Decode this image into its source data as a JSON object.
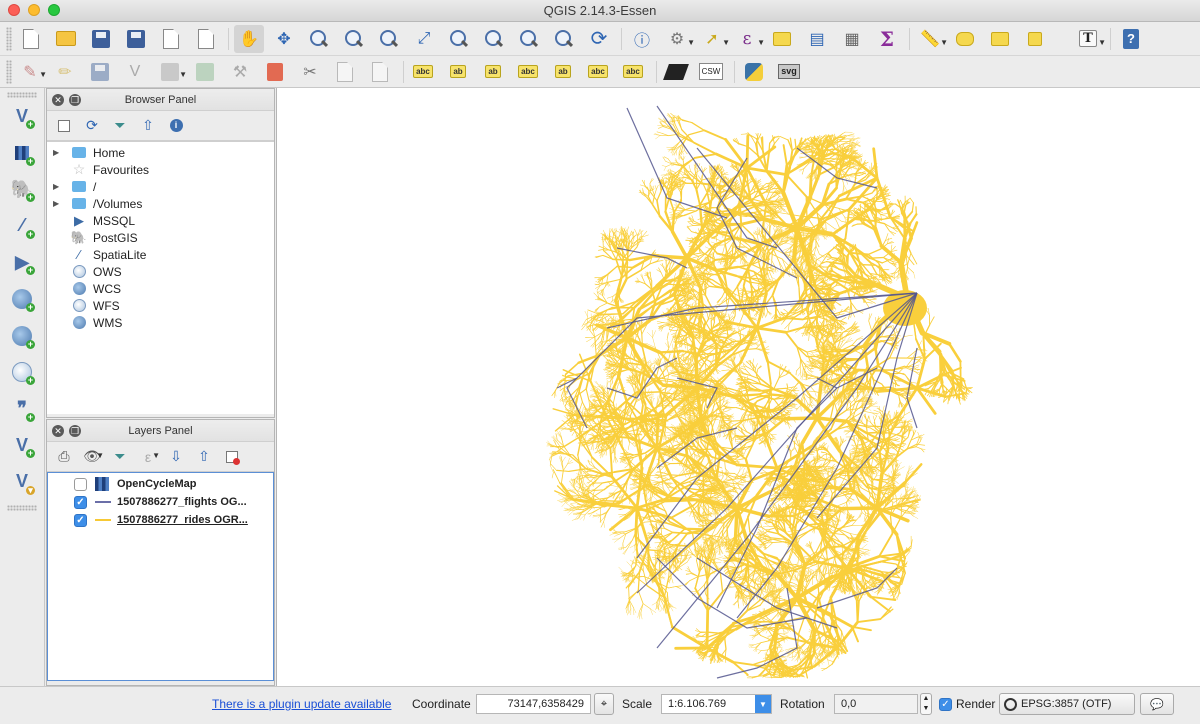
{
  "window": {
    "title": "QGIS 2.14.3-Essen"
  },
  "toolbar1": {
    "icons": [
      "new-project-icon",
      "open-project-icon",
      "save-project-icon",
      "save-as-icon",
      "new-print-composer-icon",
      "composer-manager-icon",
      "pan-icon",
      "pan-to-selection-icon",
      "zoom-in-icon",
      "zoom-out-icon",
      "zoom-actual-icon",
      "zoom-full-icon",
      "zoom-to-selection-icon",
      "zoom-to-layer-icon",
      "zoom-last-icon",
      "zoom-next-icon",
      "refresh-icon",
      "identify-icon",
      "actions-icon",
      "select-features-icon",
      "field-calculator-icon",
      "deselect-icon",
      "attribute-table-icon",
      "statistics-icon",
      "sigma-icon",
      "measure-icon",
      "map-tips-icon",
      "new-bookmark-icon",
      "show-bookmarks-icon",
      "text-annotation-icon",
      "help-icon"
    ]
  },
  "toolbar2": {
    "icons": [
      "current-edits-icon",
      "toggle-editing-icon",
      "save-edits-icon",
      "digitize-icon",
      "add-feature-icon",
      "move-feature-icon",
      "node-tool-icon",
      "delete-selected-icon",
      "cut-features-icon",
      "copy-features-icon",
      "paste-features-icon",
      "label-tool-icon",
      "pin-labels-icon",
      "highlight-labels-icon",
      "show-hide-labels-icon",
      "move-label-icon",
      "rotate-label-icon",
      "change-label-icon",
      "dark-plugin-icon",
      "csw-icon",
      "python-console-icon",
      "svg-plugin-icon"
    ],
    "csw_label": "CSW",
    "svg_label": "svg"
  },
  "left_toolbar": {
    "icons": [
      "add-vector-layer-icon",
      "add-raster-layer-icon",
      "add-postgis-layer-icon",
      "add-spatialite-layer-icon",
      "add-mssql-layer-icon",
      "add-wms-layer-icon",
      "add-wcs-layer-icon",
      "add-wfs-layer-icon",
      "add-delimited-text-icon",
      "add-virtual-layer-icon",
      "new-shapefile-layer-icon"
    ]
  },
  "browser_panel": {
    "title": "Browser Panel",
    "items": [
      {
        "label": "Home",
        "icon": "folder-icon",
        "expandable": true
      },
      {
        "label": "Favourites",
        "icon": "star-icon",
        "expandable": false
      },
      {
        "label": "/",
        "icon": "folder-icon",
        "expandable": true
      },
      {
        "label": "/Volumes",
        "icon": "folder-icon",
        "expandable": true
      },
      {
        "label": "MSSQL",
        "icon": "mssql-icon",
        "expandable": false
      },
      {
        "label": "PostGIS",
        "icon": "postgis-icon",
        "expandable": false
      },
      {
        "label": "SpatiaLite",
        "icon": "spatialite-icon",
        "expandable": false
      },
      {
        "label": "OWS",
        "icon": "ows-globe-icon",
        "expandable": false
      },
      {
        "label": "WCS",
        "icon": "wcs-globe-icon",
        "expandable": false
      },
      {
        "label": "WFS",
        "icon": "wfs-globe-icon",
        "expandable": false
      },
      {
        "label": "WMS",
        "icon": "wms-globe-icon",
        "expandable": false
      }
    ]
  },
  "layers_panel": {
    "title": "Layers Panel",
    "layers": [
      {
        "name": "OpenCycleMap",
        "checked": false,
        "symbol": "raster-tiles",
        "color": "#1f3f7a"
      },
      {
        "name": "1507886277_flights OG...",
        "checked": true,
        "symbol": "line",
        "color": "#6b6fa8"
      },
      {
        "name": "1507886277_rides OGR...",
        "checked": true,
        "symbol": "line",
        "color": "#f7c935"
      }
    ]
  },
  "map": {
    "rides_color": "#f9cf3c",
    "flights_color": "#54568e",
    "background": "#ffffff"
  },
  "statusbar": {
    "plugin_update_text": "There is a plugin update available",
    "coordinate_label": "Coordinate",
    "coordinate_value": "73147,6358429",
    "scale_label": "Scale",
    "scale_value": "1:6.106.769",
    "rotation_label": "Rotation",
    "rotation_value": "0,0",
    "render_label": "Render",
    "render_checked": true,
    "crs_value": "EPSG:3857 (OTF)"
  }
}
